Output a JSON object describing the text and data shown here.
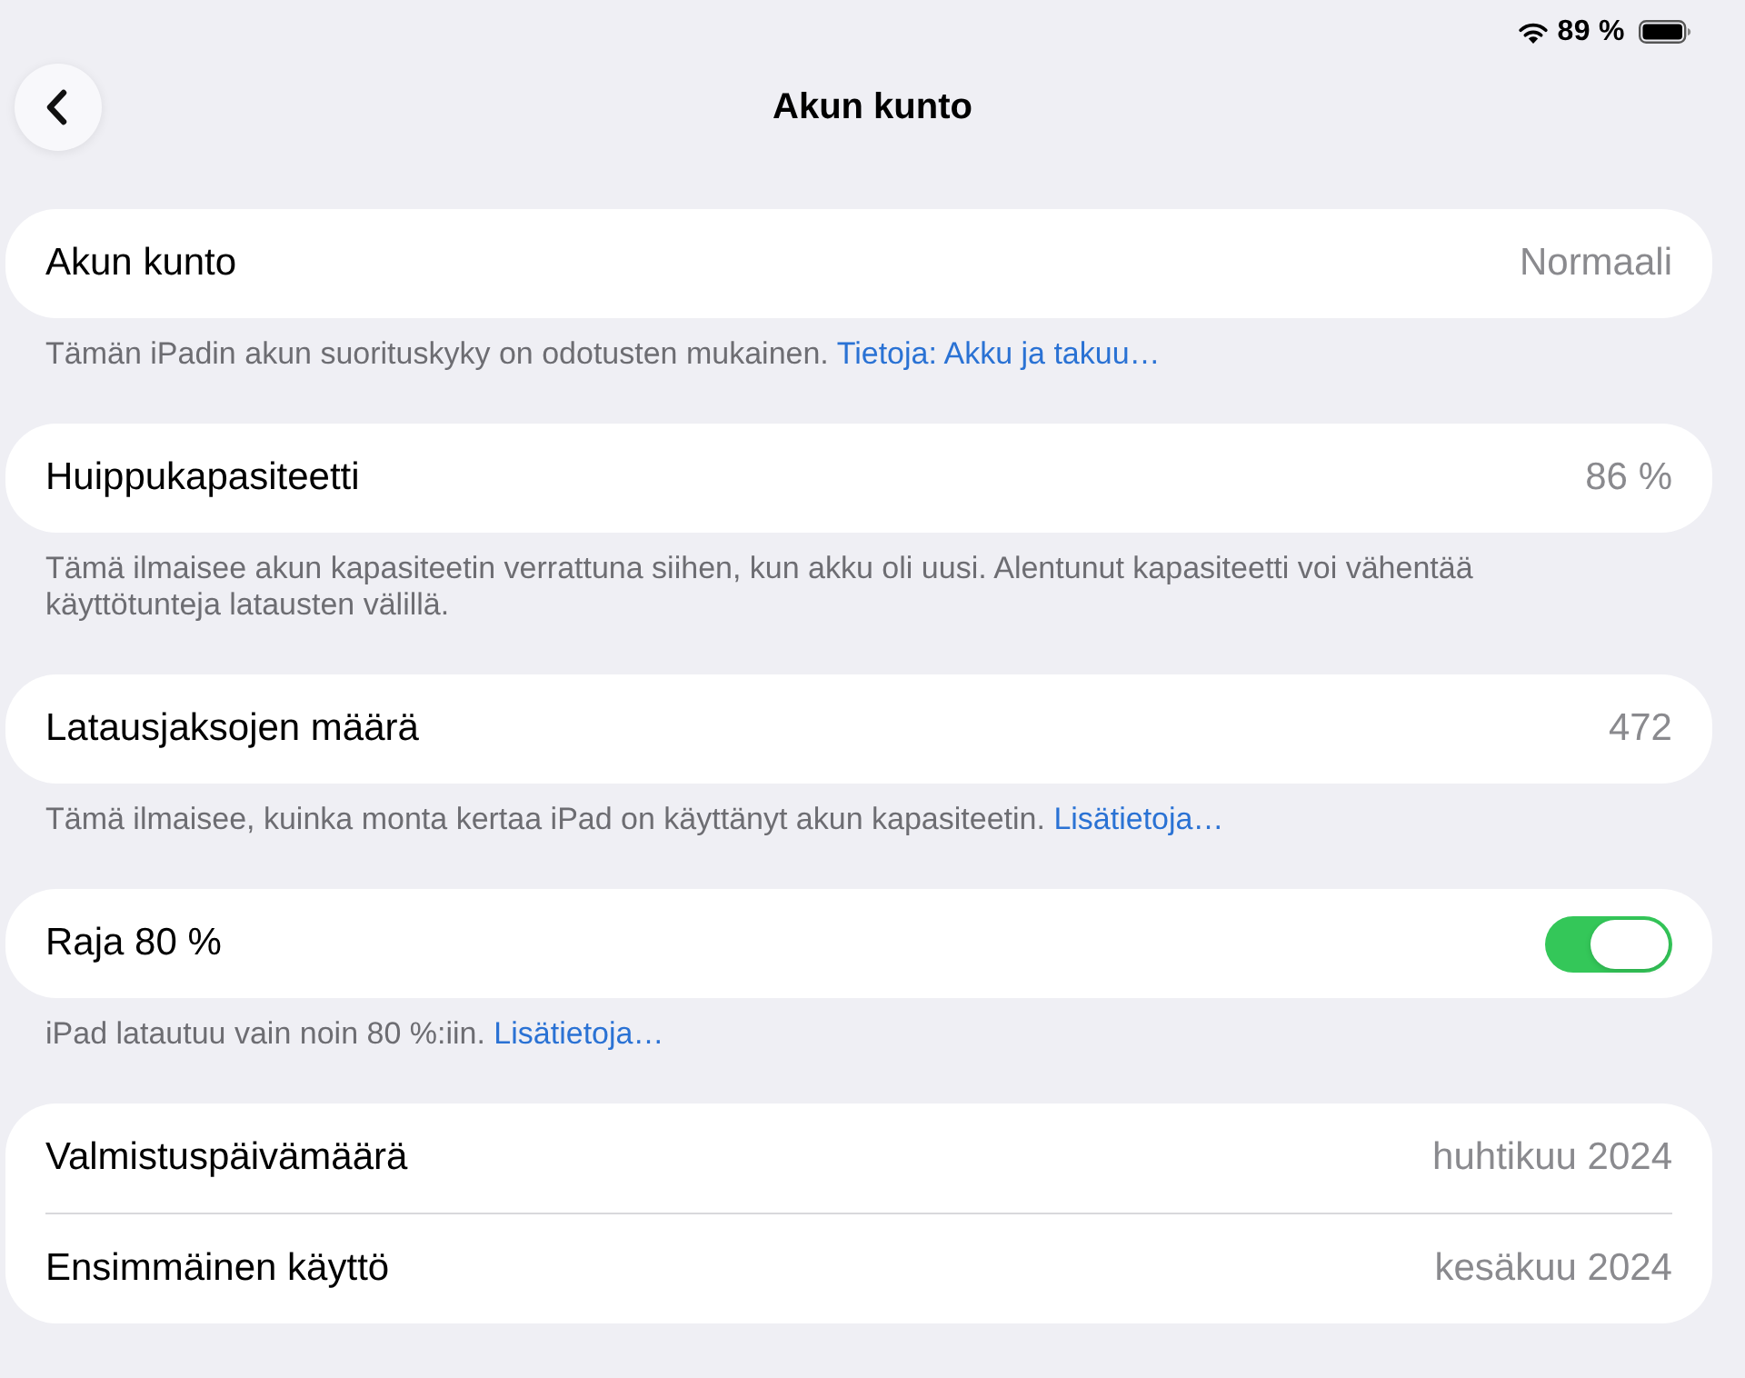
{
  "status_bar": {
    "battery": "89 %"
  },
  "navigation": {
    "title": "Akun kunto"
  },
  "groups": [
    {
      "rows": [
        {
          "kind": "value",
          "label": "Akun kunto",
          "value": "Normaali"
        }
      ],
      "footer": {
        "text": "Tämän iPadin akun suorituskyky on odotusten mukainen.",
        "link": "Tietoja: Akku ja takuu…"
      }
    },
    {
      "rows": [
        {
          "kind": "value",
          "label": "Huippukapasiteetti",
          "value": "86 %"
        }
      ],
      "footer": {
        "text": "Tämä ilmaisee akun kapasiteetin verrattuna siihen, kun akku oli uusi. Alentunut kapasiteetti voi vähentää käyttötunteja latausten välillä."
      }
    },
    {
      "rows": [
        {
          "kind": "value",
          "label": "Latausjaksojen määrä",
          "value": "472"
        }
      ],
      "footer": {
        "text": "Tämä ilmaisee, kuinka monta kertaa iPad on käyttänyt akun kapasiteetin.",
        "link": "Lisätietoja…"
      }
    },
    {
      "rows": [
        {
          "kind": "toggle",
          "label": "Raja 80 %",
          "on": true
        }
      ],
      "footer": {
        "text": "iPad latautuu vain noin 80 %:iin.",
        "link": "Lisätietoja…"
      }
    },
    {
      "rows": [
        {
          "kind": "value",
          "label": "Valmistuspäivämäärä",
          "value": "huhtikuu 2024"
        },
        {
          "kind": "value",
          "label": "Ensimmäinen käyttö",
          "value": "kesäkuu 2024"
        }
      ]
    }
  ]
}
